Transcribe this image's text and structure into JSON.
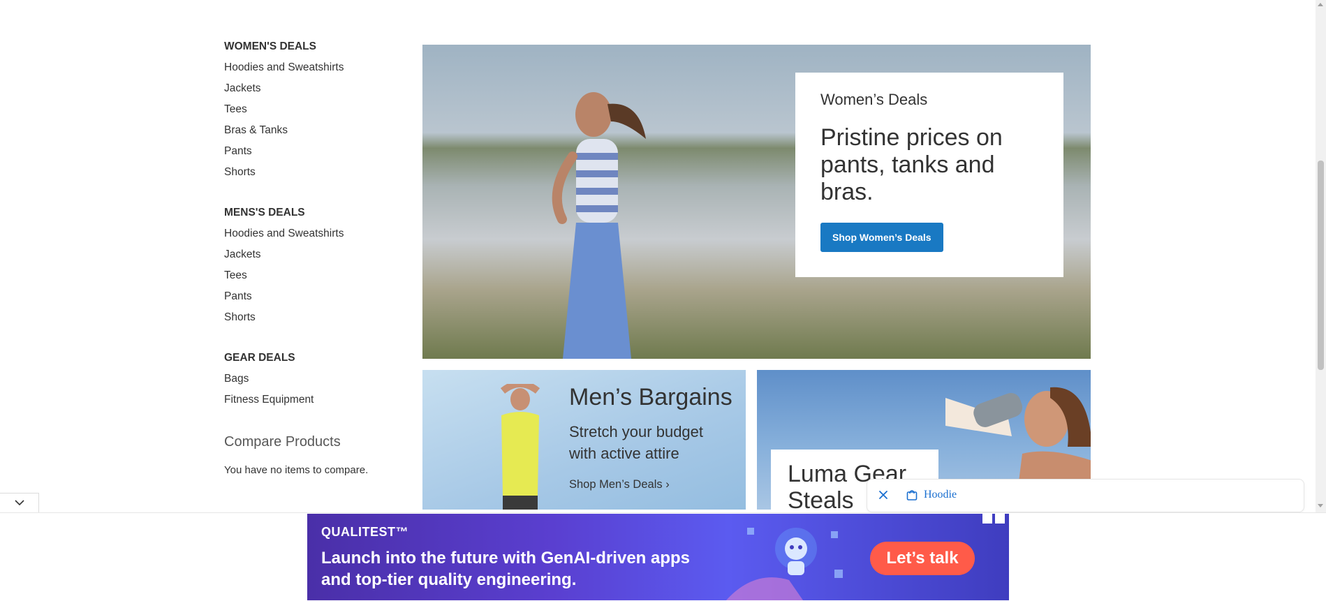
{
  "sidebar": {
    "sections": [
      {
        "heading": "WOMEN'S DEALS",
        "links": [
          "Hoodies and Sweatshirts",
          "Jackets",
          "Tees",
          "Bras & Tanks",
          "Pants",
          "Shorts"
        ]
      },
      {
        "heading": "MENS'S DEALS",
        "links": [
          "Hoodies and Sweatshirts",
          "Jackets",
          "Tees",
          "Pants",
          "Shorts"
        ]
      },
      {
        "heading": "GEAR DEALS",
        "links": [
          "Bags",
          "Fitness Equipment"
        ]
      }
    ],
    "compare": {
      "title": "Compare Products",
      "empty_text": "You have no items to compare."
    }
  },
  "hero": {
    "subtitle": "Women’s Deals",
    "headline": "Pristine prices on pants, tanks and bras.",
    "button_label": "Shop Women’s Deals",
    "button_color": "#1979c3"
  },
  "mens_tile": {
    "title": "Men’s Bargains",
    "text": "Stretch your budget with active attire",
    "link": "Shop Men’s Deals"
  },
  "gear_tile": {
    "title": "Luma Gear Steals"
  },
  "search_widget": {
    "query": "Hoodie",
    "close_icon": "close-icon",
    "bag_icon": "shopping-bag-icon"
  },
  "ad": {
    "brand": "QUALITEST™",
    "copy": "Launch into the future with GenAI-driven apps and top-tier quality engineering.",
    "cta": "Let’s talk",
    "cta_color": "#ff5b49"
  }
}
